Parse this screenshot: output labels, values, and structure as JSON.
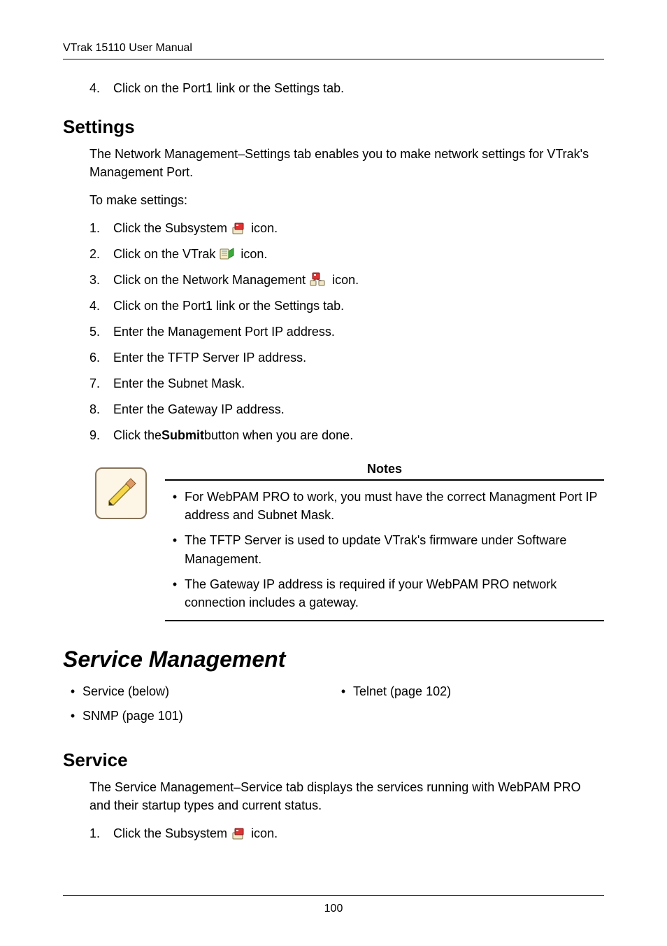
{
  "header": {
    "title": "VTrak 15110 User Manual"
  },
  "top_step": {
    "num": "4.",
    "text": "Click on the Port1 link or the Settings tab."
  },
  "settings": {
    "heading": "Settings",
    "intro": "The Network Management–Settings tab enables you to make network settings for VTrak's Management Port.",
    "to_make": "To make settings:",
    "steps": [
      {
        "num": "1.",
        "before": "Click the Subsystem ",
        "icon": "subsystem-icon",
        "after": " icon."
      },
      {
        "num": "2.",
        "before": "Click on the VTrak ",
        "icon": "vtrak-icon",
        "after": " icon."
      },
      {
        "num": "3.",
        "before": "Click on the Network Management ",
        "icon": "network-mgmt-icon",
        "after": " icon."
      },
      {
        "num": "4.",
        "before": "Click on the Port1 link or the Settings tab.",
        "icon": null,
        "after": ""
      },
      {
        "num": "5.",
        "before": "Enter the Management Port IP address.",
        "icon": null,
        "after": ""
      },
      {
        "num": "6.",
        "before": "Enter the TFTP Server IP address.",
        "icon": null,
        "after": ""
      },
      {
        "num": "7.",
        "before": "Enter the Subnet Mask.",
        "icon": null,
        "after": ""
      },
      {
        "num": "8.",
        "before": "Enter the Gateway IP address.",
        "icon": null,
        "after": ""
      },
      {
        "num": "9.",
        "before": "Click the ",
        "bold": "Submit",
        "after": " button when you are done.",
        "icon": null
      }
    ]
  },
  "notes": {
    "title": "Notes",
    "items": [
      "For WebPAM PRO to work, you must have the correct Managment Port IP address and Subnet Mask.",
      "The TFTP Server is used to update VTrak's firmware under Software Management.",
      "The Gateway IP address is required if your WebPAM PRO network connection includes a gateway."
    ]
  },
  "service_mgmt": {
    "heading": "Service Management",
    "links_left": [
      "Service (below)",
      "SNMP (page 101)"
    ],
    "links_right": [
      "Telnet (page 102)"
    ]
  },
  "service": {
    "heading": "Service",
    "intro": "The Service Management–Service tab displays the services running with WebPAM PRO and their startup types and current status.",
    "step1": {
      "num": "1.",
      "before": "Click the Subsystem ",
      "icon": "subsystem-icon",
      "after": " icon."
    }
  },
  "footer": {
    "page": "100"
  },
  "icons": {
    "subsystem-icon": "subsystem",
    "vtrak-icon": "vtrak",
    "network-mgmt-icon": "network",
    "pencil-icon": "pencil"
  }
}
